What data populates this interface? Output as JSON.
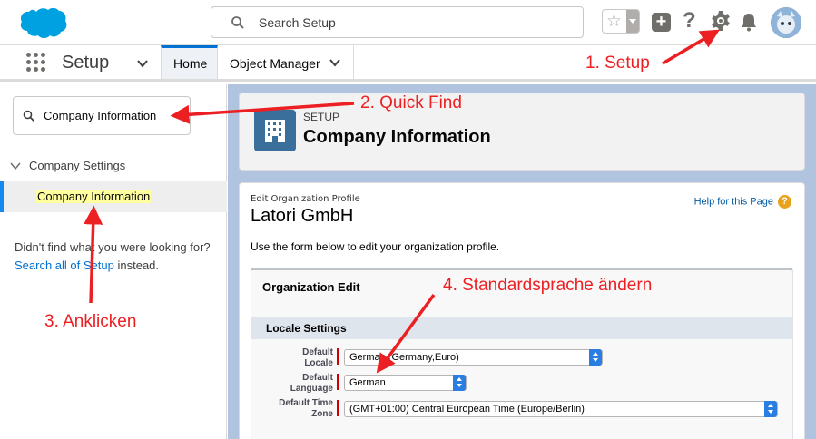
{
  "header": {
    "search_placeholder": "Search Setup",
    "icons": [
      "salesforce-cloud-icon",
      "search-icon",
      "star-icon",
      "plus-icon",
      "help-icon",
      "gear-icon",
      "bell-icon",
      "avatar"
    ]
  },
  "nav": {
    "app_name": "Setup",
    "tabs": [
      {
        "label": "Home",
        "active": true
      },
      {
        "label": "Object Manager",
        "active": false
      }
    ]
  },
  "sidebar": {
    "quick_find_value": "Company Information",
    "tree_parent": "Company Settings",
    "tree_child": "Company Information",
    "not_found_text": "Didn't find what you were looking for?",
    "search_all_link": "Search all of Setup",
    "instead_text": "instead."
  },
  "page_header": {
    "eyebrow": "SETUP",
    "title": "Company Information"
  },
  "content": {
    "eyebrow": "Edit Organization Profile",
    "org_name": "Latori GmbH",
    "help_link": "Help for this Page",
    "intro": "Use the form below to edit your organization profile.",
    "block_title": "Organization Edit",
    "section_title": "Locale Settings",
    "fields": [
      {
        "label_1": "Default",
        "label_2": "Locale",
        "value": "German (Germany,Euro)"
      },
      {
        "label_1": "Default",
        "label_2": "Language",
        "value": "German"
      },
      {
        "label_1": "Default Time",
        "label_2": "Zone",
        "value": "(GMT+01:00) Central European Time (Europe/Berlin)"
      }
    ]
  },
  "annotations": {
    "step1": "1. Setup",
    "step2": "2. Quick Find",
    "step3": "3. Anklicken",
    "step4": "4. Standardsprache ändern",
    "color": "#ec1f22"
  },
  "colors": {
    "brand_blue": "#00a1e0",
    "accent": "#0070d2",
    "page_bg": "#b0c4df"
  }
}
